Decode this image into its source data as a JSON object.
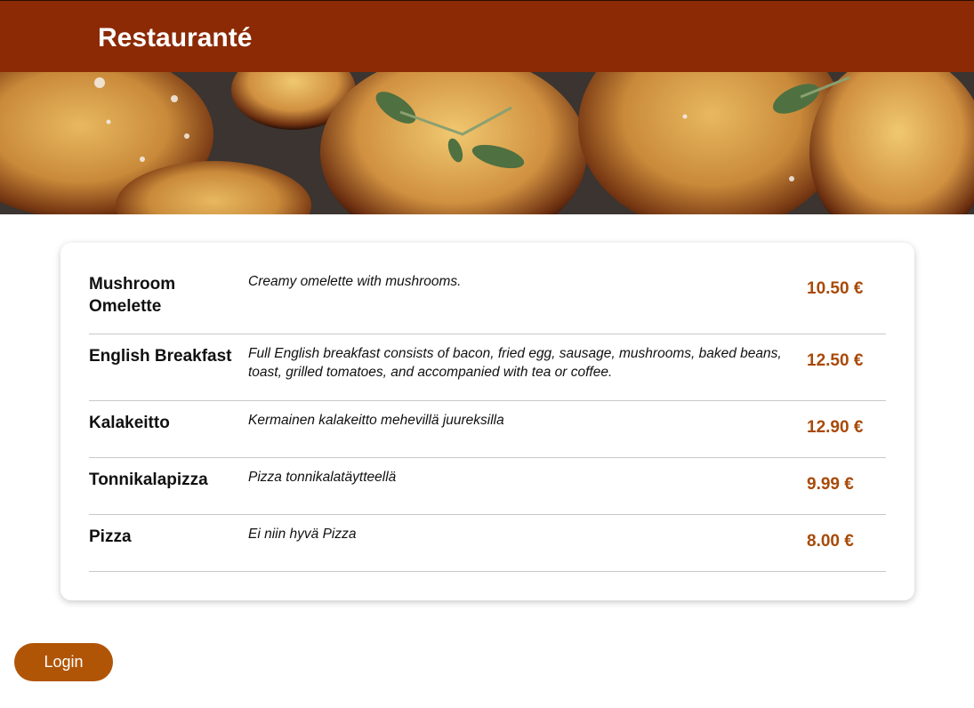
{
  "header": {
    "brand": "Restauranté",
    "accent": "#8b2a04"
  },
  "hero": {
    "image": "roasted-potatoes-with-thyme"
  },
  "menu": {
    "items": [
      {
        "name": "Mushroom Omelette",
        "description": "Creamy omelette with mushrooms.",
        "price": "10.50 €"
      },
      {
        "name": "English Breakfast",
        "description": "Full English breakfast consists of bacon, fried egg, sausage, mushrooms, baked beans, toast, grilled tomatoes, and accompanied with tea or coffee.",
        "price": "12.50 €"
      },
      {
        "name": "Kalakeitto",
        "description": "Kermainen kalakeitto mehevillä juureksilla",
        "price": "12.90 €"
      },
      {
        "name": "Tonnikalapizza",
        "description": "Pizza tonnikalatäytteellä",
        "price": "9.99 €"
      },
      {
        "name": "Pizza",
        "description": "Ei niin hyvä Pizza",
        "price": "8.00 €"
      }
    ],
    "price_color": "#a84a08"
  },
  "footer": {
    "login_label": "Login",
    "button_color": "#b05506"
  }
}
